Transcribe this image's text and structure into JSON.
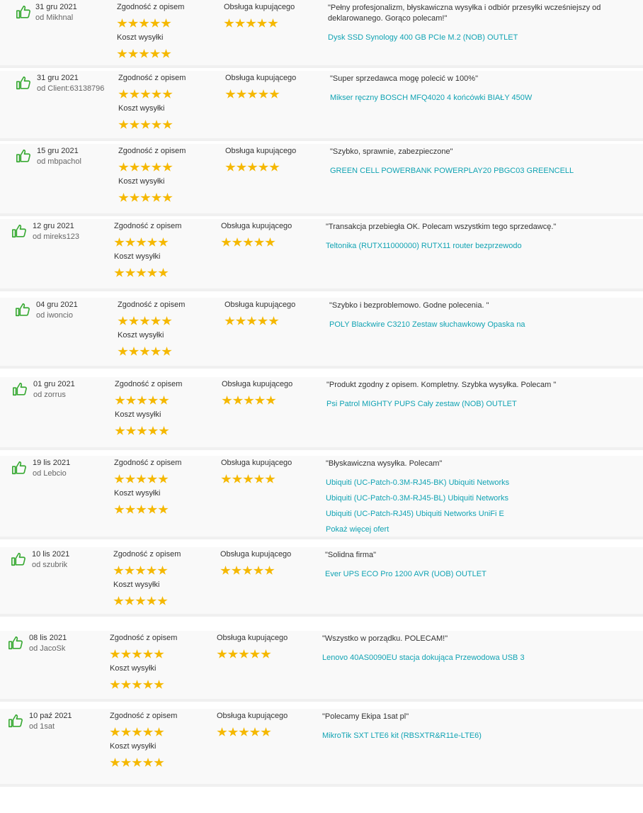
{
  "labels": {
    "description": "Zgodność z opisem",
    "service": "Obsługa kupującego",
    "shipping": "Koszt wysyłki",
    "more_offers": "Pokaż więcej ofert"
  },
  "colors": {
    "star": "#f5b800",
    "thumb": "#3aaa35",
    "link": "#11a3b3"
  },
  "icons": {
    "thumb": "thumbs-up-icon",
    "star": "star-icon"
  },
  "reviews": [
    {
      "date": "31 gru 2021",
      "user": "od Mikhnal",
      "rating_description": 5,
      "rating_service": 5,
      "rating_shipping": 5,
      "comment": "\"Pełny profesjonalizm, błyskawiczna wysyłka i odbiór przesyłki wcześniejszy od deklarowanego. Gorąco polecam!\"",
      "products": [
        "Dysk SSD Synology 400 GB PCIe M.2 (NOB) OUTLET"
      ]
    },
    {
      "date": "31 gru 2021",
      "user": "od Client:63138796",
      "rating_description": 5,
      "rating_service": 5,
      "rating_shipping": 5,
      "comment": "\"Super sprzedawca mogę polecić w 100%\"",
      "products": [
        "Mikser ręczny BOSCH MFQ4020 4 końcówki BIAŁY 450W"
      ]
    },
    {
      "date": "15 gru 2021",
      "user": "od mbpachol",
      "rating_description": 5,
      "rating_service": 5,
      "rating_shipping": 5,
      "comment": "\"Szybko, sprawnie, zabezpieczone\"",
      "products": [
        "GREEN CELL POWERBANK POWERPLAY20 PBGC03 GREENCELL"
      ]
    },
    {
      "date": "12 gru 2021",
      "user": "od mireks123",
      "rating_description": 5,
      "rating_service": 5,
      "rating_shipping": 5,
      "comment": "\"Transakcja przebiegła OK. Polecam wszystkim tego sprzedawcę.\"",
      "products": [
        "Teltonika (RUTX11000000) RUTX11 router bezprzewodo"
      ]
    },
    {
      "date": "04 gru 2021",
      "user": "od iwoncio",
      "rating_description": 5,
      "rating_service": 5,
      "rating_shipping": 5,
      "comment": "\"Szybko i bezproblemowo. Godne polecenia. \"",
      "products": [
        "POLY Blackwire C3210 Zestaw słuchawkowy Opaska na"
      ]
    },
    {
      "date": "01 gru 2021",
      "user": "od zorrus",
      "rating_description": 5,
      "rating_service": 5,
      "rating_shipping": 5,
      "comment": "\"Produkt zgodny z opisem. Kompletny. Szybka wysyłka. Polecam \"",
      "products": [
        "Psi Patrol MIGHTY PUPS Cały zestaw (NOB) OUTLET"
      ]
    },
    {
      "date": "19 lis 2021",
      "user": "od Lebcio",
      "rating_description": 5,
      "rating_service": 5,
      "rating_shipping": 5,
      "comment": "\"Błyskawiczna wysyłka. Polecam\"",
      "products": [
        "Ubiquiti (UC-Patch-0.3M-RJ45-BK) Ubiquiti Networks",
        "Ubiquiti (UC-Patch-0.3M-RJ45-BL) Ubiquiti Networks",
        "Ubiquiti (UC-Patch-RJ45) Ubiquiti Networks UniFi E"
      ],
      "more_offers": true
    },
    {
      "date": "10 lis 2021",
      "user": "od szubrik",
      "rating_description": 5,
      "rating_service": 5,
      "rating_shipping": 5,
      "comment": "\"Solidna firma\"",
      "products": [
        "Ever UPS ECO Pro 1200 AVR (UOB) OUTLET"
      ]
    },
    {
      "date": "08 lis 2021",
      "user": "od JacoSk",
      "rating_description": 5,
      "rating_service": 5,
      "rating_shipping": 5,
      "comment": "\"Wszystko w porządku. POLECAM!\"",
      "products": [
        "Lenovo 40AS0090EU stacja dokująca Przewodowa USB 3"
      ]
    },
    {
      "date": "10 paź 2021",
      "user": "od 1sat",
      "rating_description": 5,
      "rating_service": 5,
      "rating_shipping": 5,
      "comment": "\"Polecamy Ekipa 1sat pl\"",
      "products": [
        "MikroTik SXT LTE6 kit (RBSXTR&R11e-LTE6)"
      ]
    }
  ]
}
